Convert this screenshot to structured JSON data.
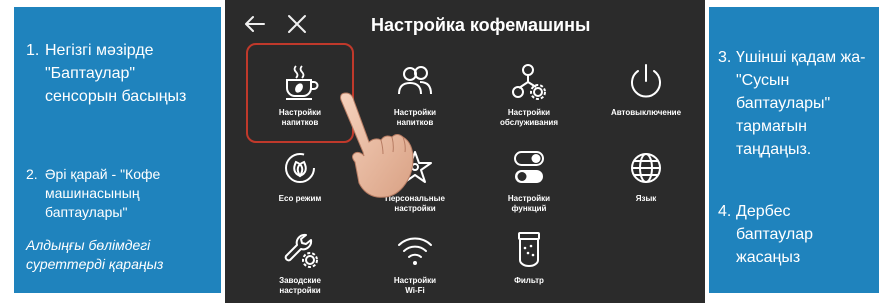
{
  "left_panel": {
    "step1": {
      "number": "1.",
      "text": "Негізгі мәзірде \"Баптаулар\" сенсорын басыңыз"
    },
    "step2": {
      "number": "2.",
      "text": "Әрі қарай - \"Кофе машинасының баптаулары\""
    },
    "step2_note": "Алдыңғы бөлімдегі суреттерді қараңыз"
  },
  "right_panel": {
    "step3": {
      "number": "3.",
      "text": "Үшінші қадам жа- \"Сусын баптаулары\" тармағын таңдаңыз."
    },
    "step4": {
      "number": "4.",
      "text": "Дербес баптаулар жасаңыз"
    }
  },
  "screen": {
    "title": "Настройка кофемашины",
    "menu_items": [
      {
        "label": "Настройки\nнапитков",
        "icon": "coffee-cup-icon",
        "selected": true
      },
      {
        "label": "Настройки\nнапитков",
        "icon": "people-icon"
      },
      {
        "label": "Настройки\nобслуживания",
        "icon": "service-icon"
      },
      {
        "label": "Автовыключение",
        "icon": "power-icon"
      },
      {
        "label": "Eco режим",
        "icon": "leaf-icon"
      },
      {
        "label": "Персональные\nнастройки",
        "icon": "star-icon"
      },
      {
        "label": "Настройки\nфункций",
        "icon": "toggle-icon"
      },
      {
        "label": "Язык",
        "icon": "globe-icon"
      },
      {
        "label": "Заводские\nнастройки",
        "icon": "wrench-icon"
      },
      {
        "label": "Настройки\nWi-Fi",
        "icon": "wifi-icon"
      },
      {
        "label": "Фильтр",
        "icon": "filter-icon"
      }
    ]
  },
  "colors": {
    "side_panel": "#1f83bd",
    "screen_bg": "#2b2b2b",
    "highlight": "#c0392b"
  }
}
